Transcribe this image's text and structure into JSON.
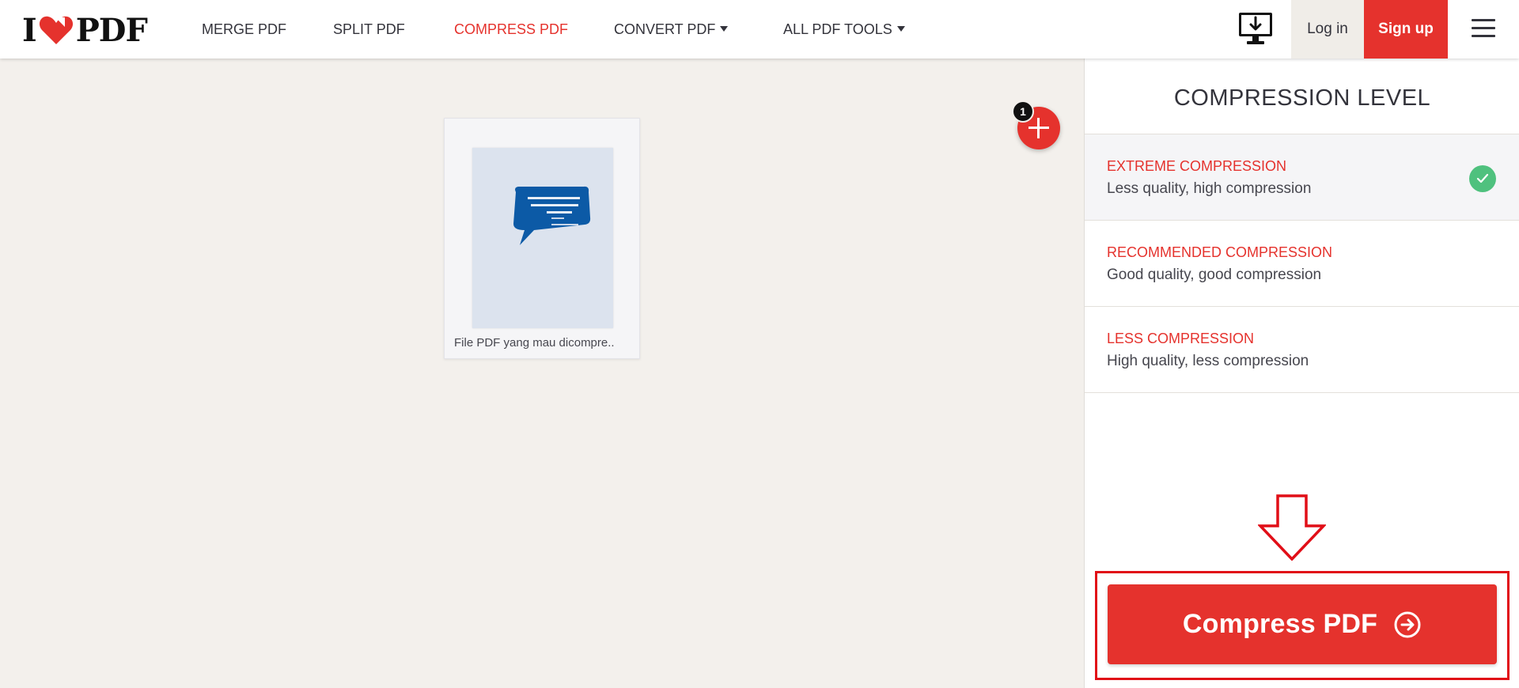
{
  "header": {
    "logo": {
      "left": "I",
      "right": "PDF"
    },
    "nav": [
      {
        "label": "MERGE PDF",
        "active": false,
        "dropdown": false
      },
      {
        "label": "SPLIT PDF",
        "active": false,
        "dropdown": false
      },
      {
        "label": "COMPRESS PDF",
        "active": true,
        "dropdown": false
      },
      {
        "label": "CONVERT PDF",
        "active": false,
        "dropdown": true
      },
      {
        "label": "ALL PDF TOOLS",
        "active": false,
        "dropdown": true
      }
    ],
    "desktop_icon": "desktop-download-icon",
    "login_label": "Log in",
    "signup_label": "Sign up",
    "menu_icon": "hamburger-menu-icon"
  },
  "workspace": {
    "file": {
      "name": "File PDF yang mau dicompre.."
    },
    "file_count": "1"
  },
  "sidebar": {
    "title": "COMPRESSION LEVEL",
    "options": [
      {
        "title": "EXTREME COMPRESSION",
        "desc": "Less quality, high compression",
        "selected": true
      },
      {
        "title": "RECOMMENDED COMPRESSION",
        "desc": "Good quality, good compression",
        "selected": false
      },
      {
        "title": "LESS COMPRESSION",
        "desc": "High quality, less compression",
        "selected": false
      }
    ],
    "compress_label": "Compress PDF"
  },
  "colors": {
    "brand_red": "#e5322d",
    "annotation_red": "#e10e17",
    "check_green": "#4fc17e",
    "workspace_bg": "#f3f0ec"
  }
}
